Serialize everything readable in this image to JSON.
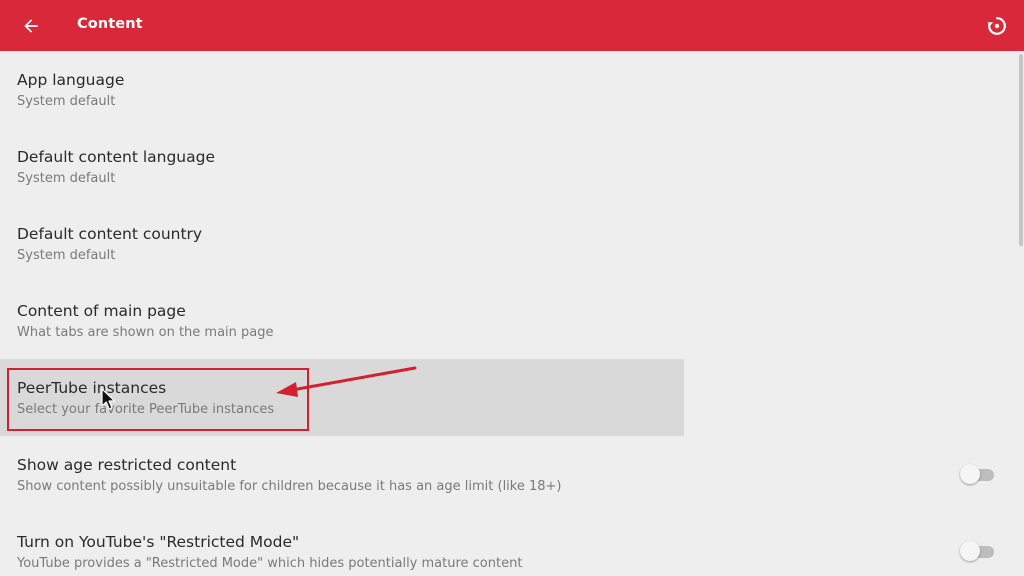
{
  "appbar": {
    "title": "Content",
    "back_icon": "arrow-back-icon",
    "restore_icon": "restore-defaults-icon",
    "background_color": "#d8283a"
  },
  "settings": {
    "items": [
      {
        "title": "App language",
        "subtitle": "System default"
      },
      {
        "title": "Default content language",
        "subtitle": "System default"
      },
      {
        "title": "Default content country",
        "subtitle": "System default"
      },
      {
        "title": "Content of main page",
        "subtitle": "What tabs are shown on the main page"
      },
      {
        "title": "PeerTube instances",
        "subtitle": "Select your favorite PeerTube instances",
        "selected": true
      },
      {
        "title": "Show age restricted content",
        "subtitle": "Show content possibly unsuitable for children because it has an age limit (like 18+)",
        "toggle": "off"
      },
      {
        "title": "Turn on YouTube's \"Restricted Mode\"",
        "subtitle": "YouTube provides a \"Restricted Mode\" which hides potentially mature content",
        "toggle": "off"
      }
    ]
  },
  "annotation": {
    "color": "#d32030",
    "target": "PeerTube instances"
  }
}
